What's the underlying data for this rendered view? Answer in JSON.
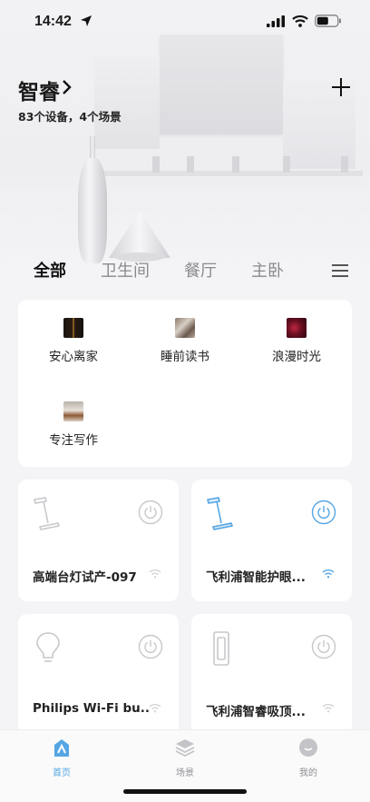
{
  "status_bar": {
    "time": "14:42"
  },
  "header": {
    "title": "智睿",
    "subtitle": "83个设备，4个场景"
  },
  "tabs": [
    {
      "label": "全部",
      "active": true
    },
    {
      "label": "卫生间",
      "active": false
    },
    {
      "label": "餐厅",
      "active": false
    },
    {
      "label": "主卧",
      "active": false
    }
  ],
  "scenes": [
    {
      "label": "安心离家",
      "thumb": "dark-doorway-thumbnail"
    },
    {
      "label": "睡前读书",
      "thumb": "reading-thumbnail"
    },
    {
      "label": "浪漫时光",
      "thumb": "romantic-red-thumbnail"
    },
    {
      "label": "专注写作",
      "thumb": "writing-desk-thumbnail"
    }
  ],
  "devices": [
    {
      "name": "高端台灯试产-097",
      "icon": "desk-lamp-icon",
      "on": false
    },
    {
      "name": "飞利浦智能护眼...",
      "icon": "desk-lamp-icon",
      "on": true
    },
    {
      "name": "Philips Wi-Fi bu...",
      "icon": "bulb-icon",
      "on": false
    },
    {
      "name": "飞利浦智睿吸顶...",
      "icon": "ceiling-light-icon",
      "on": false
    }
  ],
  "bottom_nav": [
    {
      "label": "首页",
      "icon": "home-icon",
      "active": true
    },
    {
      "label": "场景",
      "icon": "layers-icon",
      "active": false
    },
    {
      "label": "我的",
      "icon": "profile-icon",
      "active": false
    }
  ],
  "colors": {
    "accent": "#55a6e3",
    "inactive_icon": "#c8c8cc",
    "background": "#f4f4f6"
  }
}
